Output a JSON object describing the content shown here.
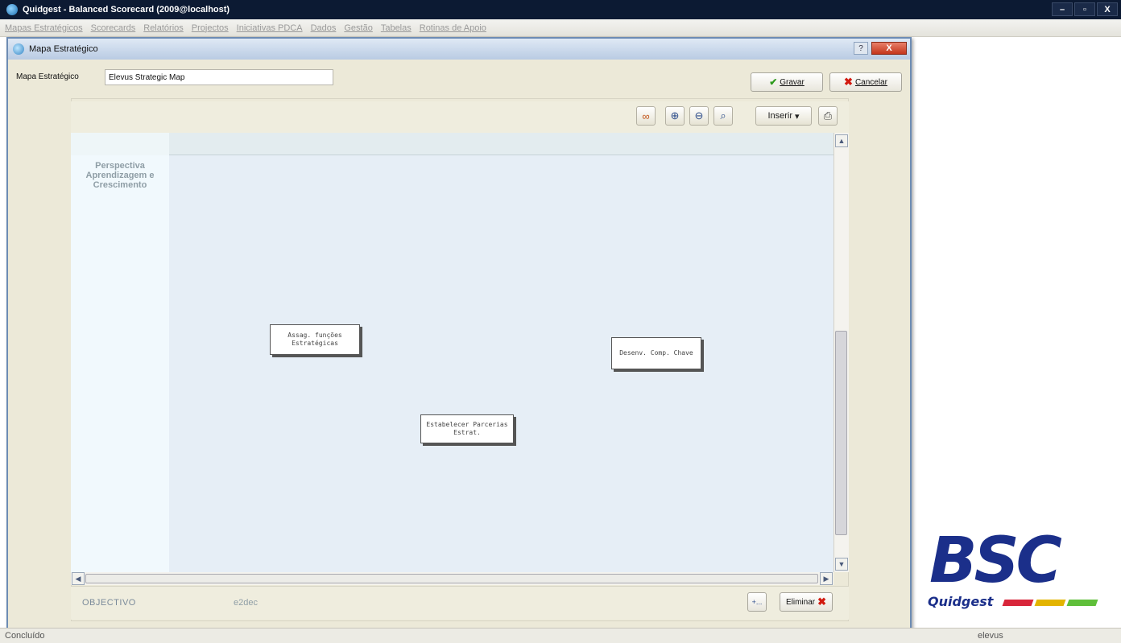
{
  "app": {
    "title": "Quidgest - Balanced Scorecard (2009@localhost)",
    "win_buttons": [
      "–",
      "▫",
      "X"
    ]
  },
  "menu": [
    "Mapas Estratégicos",
    "Scorecards",
    "Relatórios",
    "Projectos",
    "Iniciativas PDCA",
    "Dados",
    "Gestão",
    "Tabelas",
    "Rotinas de Apoio"
  ],
  "dialog": {
    "title": "Mapa Estratégico",
    "help": "?",
    "close": "X",
    "field_label": "Mapa Estratégico",
    "field_value": "Elevus Strategic Map",
    "save_label": "Gravar",
    "cancel_label": "Cancelar"
  },
  "toolbar": {
    "insert_label": "Inserir"
  },
  "map": {
    "perspective": "Perspectiva Aprendizagem e Crescimento",
    "nodes": [
      "Assag. funções Estratégicas",
      "Desenv. Comp. Chave",
      "Estabelecer Parcerias Estrat."
    ]
  },
  "bottom": {
    "objective_label": "OBJECTIVO",
    "objective_value": "e2dec",
    "add_label": "+...",
    "delete_label": "Eliminar"
  },
  "logo": {
    "letters": "BSC",
    "brand": "Quidgest",
    "bar_colors": [
      "#d8263a",
      "#e3b400",
      "#5fbf3a"
    ]
  },
  "status": {
    "left": "Concluído",
    "user": "elevus"
  },
  "colors": {
    "accent": "#1b2f8a",
    "canvas": "#e6eef6",
    "danger": "#d21a10",
    "success": "#2e9b1e"
  }
}
